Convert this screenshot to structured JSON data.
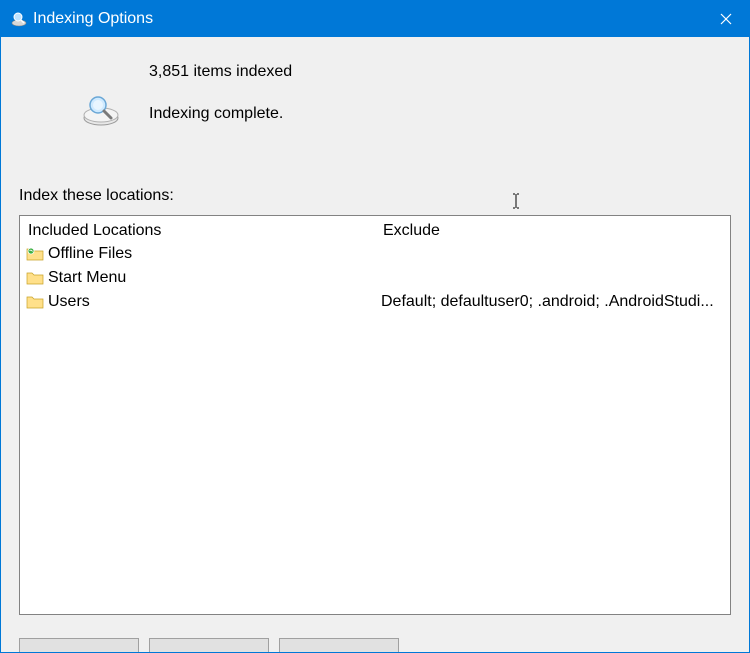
{
  "titlebar": {
    "title": "Indexing Options"
  },
  "status": {
    "count_line": "3,851 items indexed",
    "state_line": "Indexing complete."
  },
  "section_label": "Index these locations:",
  "columns": {
    "included_header": "Included Locations",
    "exclude_header": "Exclude"
  },
  "locations": [
    {
      "label": "Offline Files",
      "exclude": ""
    },
    {
      "label": "Start Menu",
      "exclude": ""
    },
    {
      "label": "Users",
      "exclude": "Default; defaultuser0; .android; .AndroidStudi..."
    }
  ]
}
